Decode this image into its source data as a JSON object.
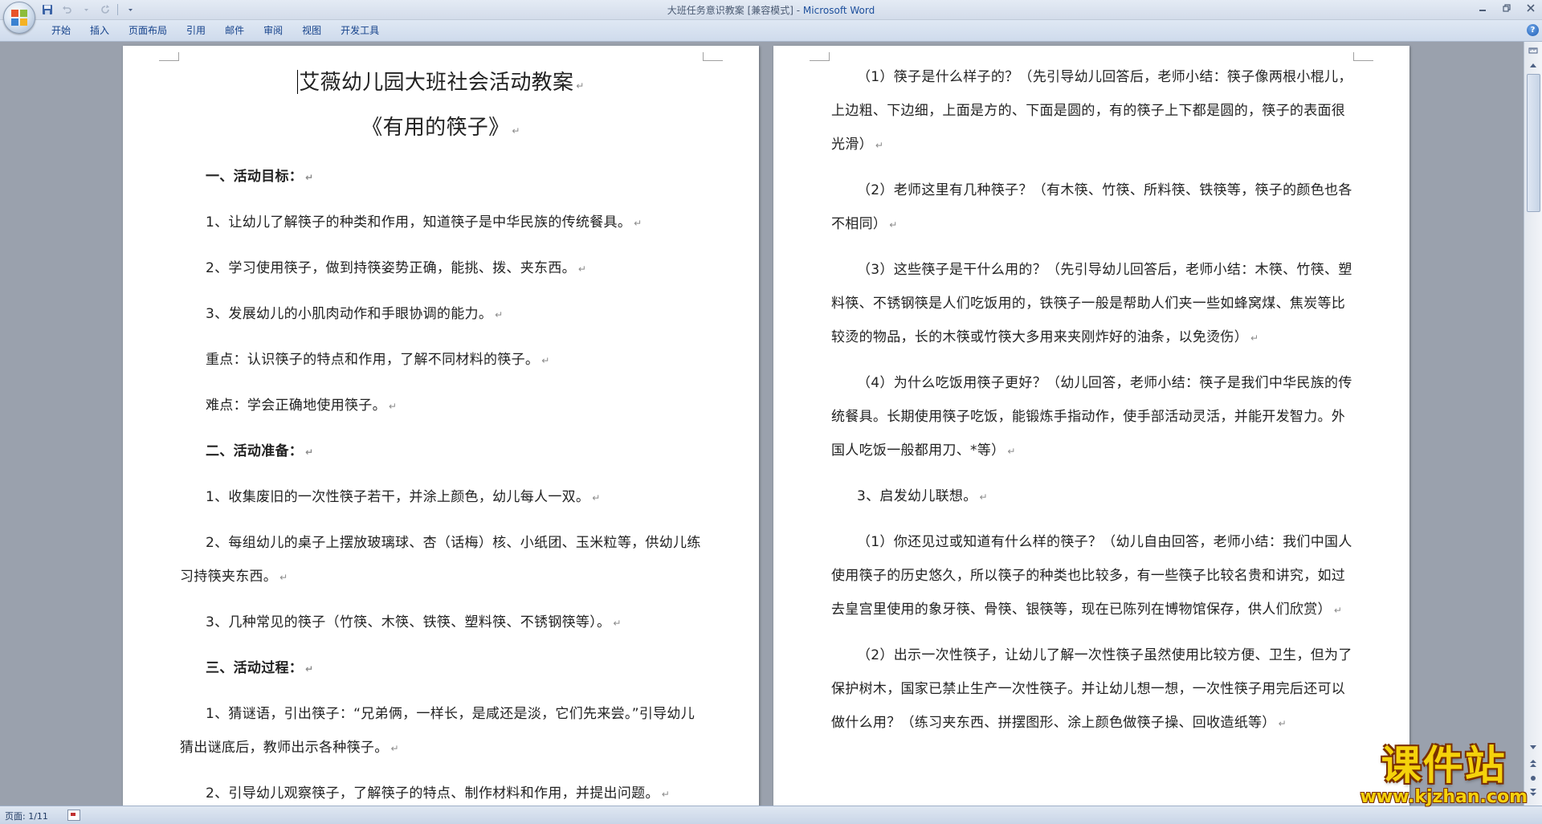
{
  "window": {
    "doc_name": "大班任务意识教案 [兼容模式] - ",
    "app_name": "Microsoft Word"
  },
  "menu_tabs": [
    "开始",
    "插入",
    "页面布局",
    "引用",
    "邮件",
    "审阅",
    "视图",
    "开发工具"
  ],
  "help_label": "?",
  "page1": {
    "title": "艾薇幼儿园大班社会活动教案",
    "subtitle": "《有用的筷子》",
    "paragraphs": [
      "一、活动目标：",
      "1、让幼儿了解筷子的种类和作用，知道筷子是中华民族的传统餐具。",
      "2、学习使用筷子，做到持筷姿势正确，能挑、拨、夹东西。",
      "3、发展幼儿的小肌肉动作和手眼协调的能力。",
      "重点：认识筷子的特点和作用，了解不同材料的筷子。",
      "难点：学会正确地使用筷子。",
      "二、活动准备：",
      "1、收集废旧的一次性筷子若干，并涂上颜色，幼儿每人一双。",
      "2、每组幼儿的桌子上摆放玻璃球、杏（话梅）核、小纸团、玉米粒等，供幼儿练习持筷夹东西。",
      "3、几种常见的筷子（竹筷、木筷、铁筷、塑料筷、不锈钢筷等）。",
      "三、活动过程：",
      "1、猜谜语，引出筷子：“兄弟俩，一样长，是咸还是淡，它们先来尝。”引导幼儿猜出谜底后，教师出示各种筷子。",
      "2、引导幼儿观察筷子，了解筷子的特点、制作材料和作用，并提出问题。"
    ]
  },
  "page2": {
    "paragraphs": [
      "（1）筷子是什么样子的？（先引导幼儿回答后，老师小结：筷子像两根小棍儿，上边粗、下边细，上面是方的、下面是圆的，有的筷子上下都是圆的，筷子的表面很光滑）",
      "（2）老师这里有几种筷子？（有木筷、竹筷、所料筷、铁筷等，筷子的颜色也各不相同）",
      "（3）这些筷子是干什么用的？（先引导幼儿回答后，老师小结：木筷、竹筷、塑料筷、不锈钢筷是人们吃饭用的，铁筷子一般是帮助人们夹一些如蜂窝煤、焦炭等比较烫的物品，长的木筷或竹筷大多用来夹刚炸好的油条，以免烫伤）",
      "（4）为什么吃饭用筷子更好？（幼儿回答，老师小结：筷子是我们中华民族的传统餐具。长期使用筷子吃饭，能锻炼手指动作，使手部活动灵活，并能开发智力。外国人吃饭一般都用刀、*等）",
      "3、启发幼儿联想。",
      "（1）你还见过或知道有什么样的筷子？（幼儿自由回答，老师小结：我们中国人使用筷子的历史悠久，所以筷子的种类也比较多，有一些筷子比较名贵和讲究，如过去皇宫里使用的象牙筷、骨筷、银筷等，现在已陈列在博物馆保存，供人们欣赏）",
      "（2）出示一次性筷子，让幼儿了解一次性筷子虽然使用比较方便、卫生，但为了保护树木，国家已禁止生产一次性筷子。并让幼儿想一想，一次性筷子用完后还可以做什么用？（练习夹东西、拼摆图形、涂上颜色做筷子操、回收造纸等）"
    ]
  },
  "status": {
    "page_info": "页面: 1/11"
  },
  "watermark": {
    "text": "课件站",
    "url": "www.kjzhan.com"
  },
  "colors": {
    "ribbon_tab_text": "#15428b",
    "title_app": "#1d4f9c",
    "background": "#9aa1ad",
    "watermark_fill": "#f5d20b"
  }
}
